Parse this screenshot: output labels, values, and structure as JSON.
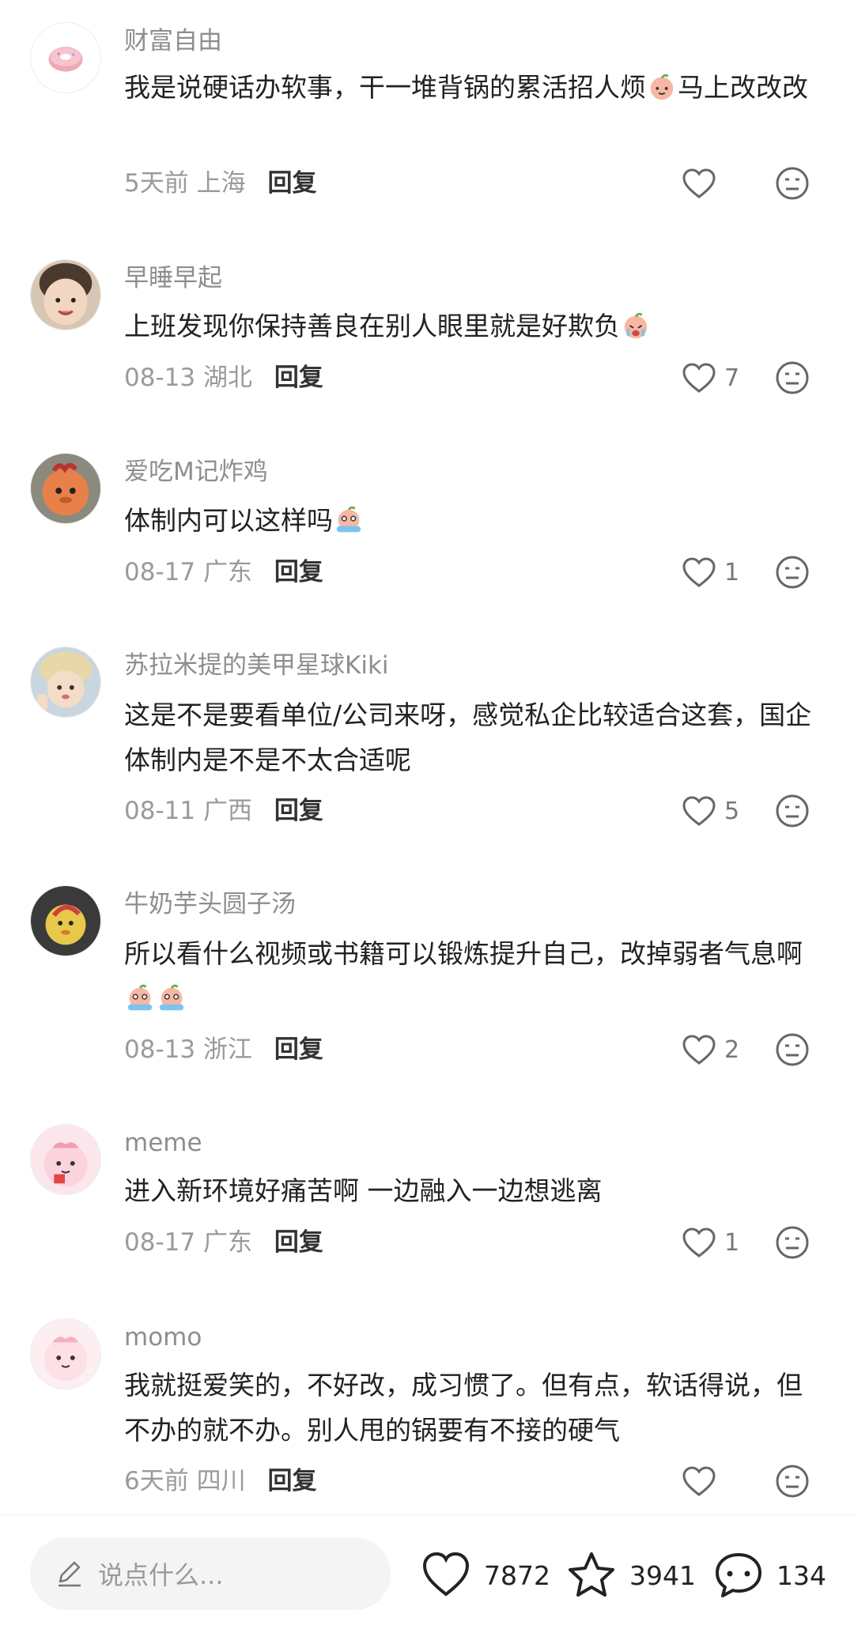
{
  "comments": [
    {
      "user": "财富自由",
      "text_a": "我是说硬话办软事，干一堆背锅的累活招人烦",
      "text_b": "马上改改改",
      "emoji": "peach-smile",
      "date": "5天前",
      "location": "上海",
      "reply": "回复",
      "likes": ""
    },
    {
      "user": "早睡早起",
      "text_a": "上班发现你保持善良在别人眼里就是好欺负",
      "text_b": "",
      "emoji": "peach-cry",
      "date": "08-13",
      "location": "湖北",
      "reply": "回复",
      "likes": "7"
    },
    {
      "user": "爱吃M记炸鸡",
      "text_a": "体制内可以这样吗",
      "text_b": "",
      "emoji": "peach-tears",
      "date": "08-17",
      "location": "广东",
      "reply": "回复",
      "likes": "1"
    },
    {
      "user": "苏拉米提的美甲星球Kiki",
      "text_a": "这是不是要看单位/公司来呀，感觉私企比较适合这套，国企体制内是不是不太合适呢",
      "text_b": "",
      "emoji": "",
      "date": "08-11",
      "location": "广西",
      "reply": "回复",
      "likes": "5"
    },
    {
      "user": "牛奶芋头圆子汤",
      "text_a": "所以看什么视频或书籍可以锻炼提升自己，改掉弱者气息啊",
      "text_b": "",
      "emoji": "peach-tears-x2",
      "date": "08-13",
      "location": "浙江",
      "reply": "回复",
      "likes": "2"
    },
    {
      "user": "meme",
      "text_a": "进入新环境好痛苦啊 一边融入一边想逃离",
      "text_b": "",
      "emoji": "",
      "date": "08-17",
      "location": "广东",
      "reply": "回复",
      "likes": "1"
    },
    {
      "user": "momo",
      "text_a": "我就挺爱笑的，不好改，成习惯了。但有点，软话得说，但不办的就不办。别人甩的锅要有不接的硬气",
      "text_b": "",
      "emoji": "",
      "date": "6天前",
      "location": "四川",
      "reply": "回复",
      "likes": ""
    }
  ],
  "bottom_bar": {
    "input_placeholder": "说点什么...",
    "likes": "7872",
    "favorites": "3941",
    "comments": "134"
  },
  "icons": {
    "like": "heart-outline-icon",
    "dislike": "meh-face-icon",
    "favorite": "star-outline-icon",
    "comment": "chat-bubble-icon",
    "input": "pencil-icon"
  },
  "colors": {
    "meta_gray": "#9a9a9a",
    "username_gray": "#8e8e8e",
    "input_bg": "#f4f4f4"
  }
}
